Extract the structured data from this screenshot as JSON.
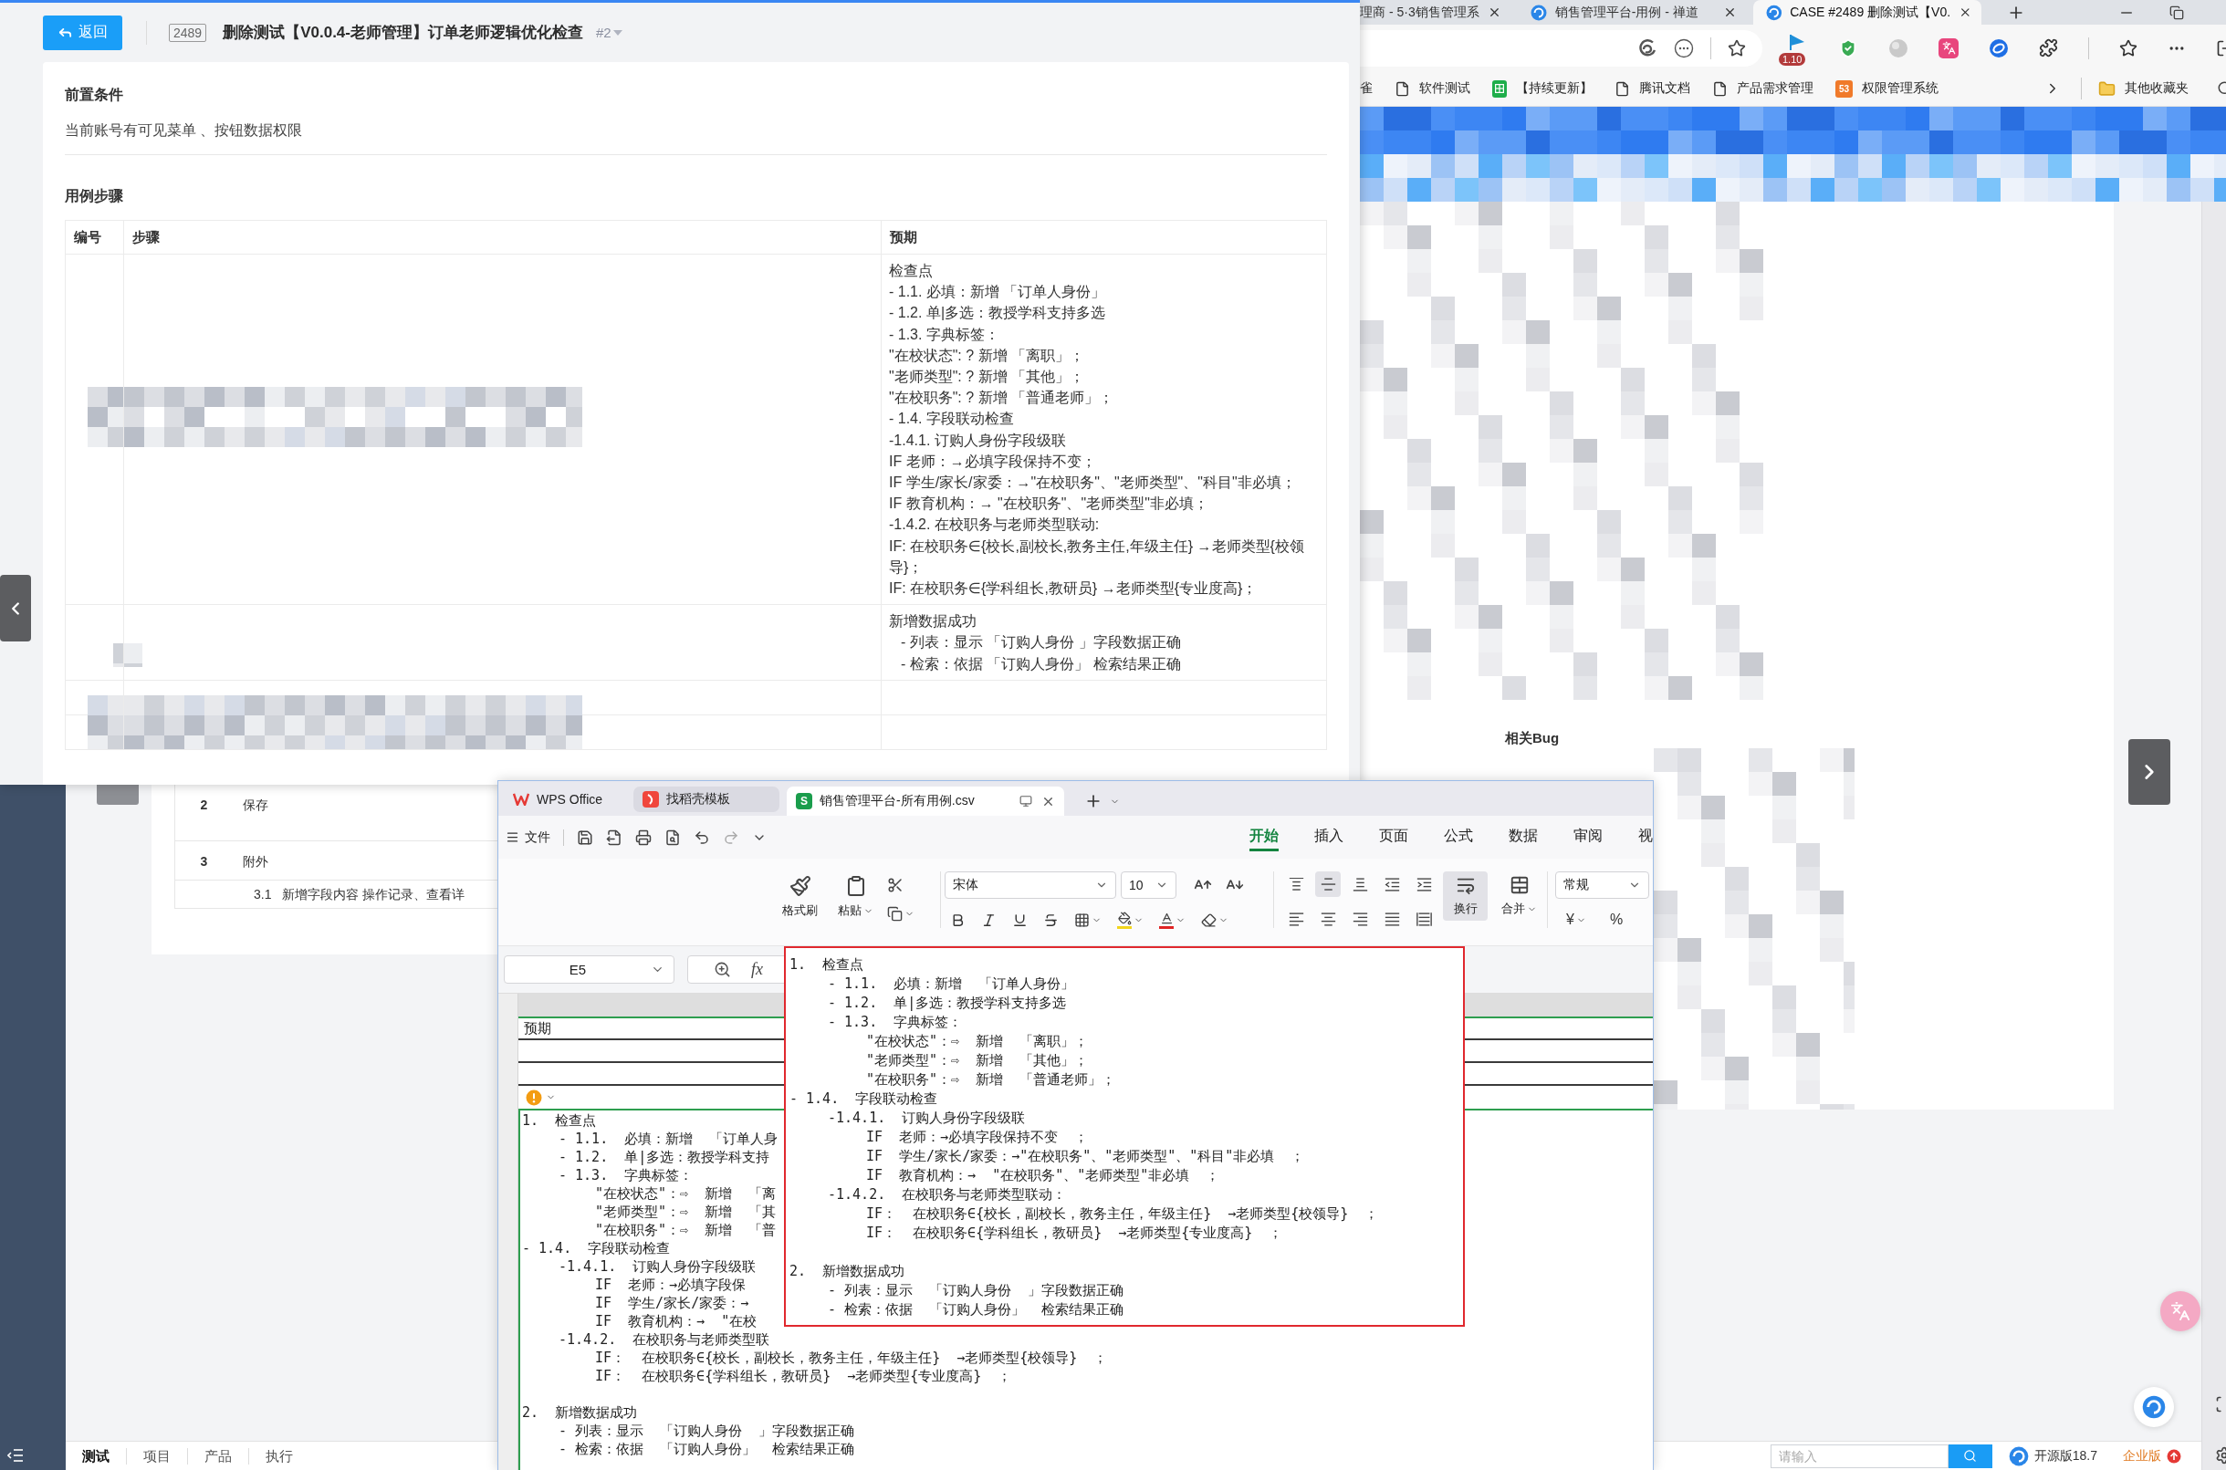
{
  "browser": {
    "tabs": [
      {
        "title": "理商 - 5·3销售管理系",
        "favicon": false,
        "selected": false
      },
      {
        "title": "销售管理平台-用例 - 禅道",
        "favicon": true,
        "selected": false
      },
      {
        "title": "CASE #2489 删除测试【V0.",
        "favicon": true,
        "selected": true
      }
    ],
    "extension_badge": "1.10",
    "bookmarks": [
      {
        "label": "雀",
        "kind": "plain"
      },
      {
        "label": "软件测试",
        "kind": "doc"
      },
      {
        "label": "【持续更新】",
        "kind": "sheet"
      },
      {
        "label": "腾讯文档",
        "kind": "doc"
      },
      {
        "label": "产品需求管理",
        "kind": "doc"
      },
      {
        "label": "权限管理系统",
        "kind": "app",
        "icon_text": "53"
      }
    ],
    "other_bookmarks": "其他收藏夹"
  },
  "page": {
    "related_title": "相关Bug",
    "steps": [
      {
        "number": "2",
        "text": "保存"
      },
      {
        "number": "3",
        "text": "附外",
        "children": [
          {
            "number": "3.1",
            "text": "新增字段内容 操作记录、查看详"
          }
        ]
      }
    ],
    "bottom_nav": [
      {
        "label": "测试",
        "selected": true
      },
      {
        "label": "项目",
        "selected": false
      },
      {
        "label": "产品",
        "selected": false
      },
      {
        "label": "执行",
        "selected": false
      }
    ],
    "search": {
      "placeholder": "请输入"
    },
    "edition": "开源版18.7",
    "upgrade": "企业版"
  },
  "case_panel": {
    "back": "返回",
    "id": "2489",
    "title": "删除测试【V0.0.4-老师管理】订单老师逻辑优化检查",
    "version": "#2",
    "precondition": {
      "heading": "前置条件",
      "text": "当前账号有可见菜单 、按钮数据权限"
    },
    "steps": {
      "heading": "用例步骤",
      "columns": [
        "编号",
        "步骤",
        "预期"
      ],
      "rows": [
        {
          "expected": [
            {
              "text": "检查点"
            },
            {
              "text": "- 1.1. 必填：新增 「订单人身份」"
            },
            {
              "text": "- 1.2. 单|多选：教授学科支持多选"
            },
            {
              "text": "- 1.3. 字典标签："
            },
            {
              "text": "\"在校状态\": ? 新增 「离职」；"
            },
            {
              "text": "\"老师类型\": ? 新增 「其他」；"
            },
            {
              "text": "\"在校职务\": ? 新增 「普通老师」；"
            },
            {
              "text": "- 1.4. 字段联动检查"
            },
            {
              "text": "-1.4.1. 订购人身份字段级联"
            },
            {
              "text": "IF 老师：→必填字段保持不变；"
            },
            {
              "text": "IF 学生/家长/家委：→\"在校职务\"、\"老师类型\"、\"科目\"非必填；"
            },
            {
              "text": "IF 教育机构：→ \"在校职务\"、\"老师类型\"非必填；"
            },
            {
              "text": "-1.4.2. 在校职务与老师类型联动:"
            },
            {
              "text": "IF: 在校职务∈{校长,副校长,教务主任,年级主任} →老师类型{校领导}；"
            },
            {
              "text": "IF: 在校职务∈{学科组长,教研员} →老师类型{专业度高}；"
            }
          ]
        },
        {
          "expected": [
            {
              "text": "新增数据成功",
              "children": [
                {
                  "text": "- 列表：显示 「订购人身份 」字段数据正确"
                },
                {
                  "text": "- 检索：依据 「订购人身份」 检索结果正确"
                }
              ]
            }
          ]
        }
      ]
    }
  },
  "wps": {
    "tabs": [
      {
        "label": "WPS Office",
        "kind": "home",
        "selected": false
      },
      {
        "label": "找稻壳模板",
        "kind": "template",
        "selected": false
      },
      {
        "label": "销售管理平台-所有用例.csv",
        "kind": "sheet",
        "icon_text": "S",
        "selected": true
      }
    ],
    "file_menu": "文件",
    "ribbon_tabs": [
      {
        "label": "开始",
        "selected": true
      },
      {
        "label": "插入",
        "selected": false
      },
      {
        "label": "页面",
        "selected": false
      },
      {
        "label": "公式",
        "selected": false
      },
      {
        "label": "数据",
        "selected": false
      },
      {
        "label": "审阅",
        "selected": false
      },
      {
        "label": "视",
        "selected": false
      }
    ],
    "toolbar": {
      "format_painter": "格式刷",
      "paste": "粘贴",
      "font": "宋体",
      "font_size": "10",
      "vertical_align_buttons": [
        {
          "kind": "top",
          "on": false
        },
        {
          "kind": "middle",
          "on": true
        },
        {
          "kind": "bottom",
          "on": false
        }
      ],
      "wrap": {
        "label": "换行",
        "on": true
      },
      "merge": "合并",
      "number_format": "常规",
      "currency": "¥",
      "percent": "%"
    },
    "name_box": "E5",
    "formula_label": "fx",
    "header_cell": "预期",
    "cell": {
      "blocks": [
        {
          "lines": [
            {
              "text": "1.  检查点",
              "children": [
                {
                  "text": "- 1.1.  必填：新增  「订单人身"
                },
                {
                  "text": "- 1.2.  单|多选：教授学科支持"
                },
                {
                  "text": "- 1.3.  字典标签：",
                  "children": [
                    {
                      "text": "\"在校状态\"：⇨  新增  「离"
                    },
                    {
                      "text": "\"老师类型\"：⇨  新增  「其"
                    },
                    {
                      "text": "\"在校职务\"：⇨  新增  「普"
                    }
                  ]
                }
              ]
            },
            {
              "text": "- 1.4.  字段联动检查",
              "children": [
                {
                  "text": "-1.4.1.  订购人身份字段级联",
                  "children": [
                    {
                      "text": "IF  老师：→必填字段保"
                    },
                    {
                      "text": "IF  学生/家长/家委：→"
                    },
                    {
                      "text": "IF  教育机构：→  \"在校"
                    }
                  ]
                },
                {
                  "text": "-1.4.2.  在校职务与老师类型联",
                  "children": [
                    {
                      "text": "IF：  在校职务∈{校长，副校长，教务主任，年级主任}  →老师类型{校领导}  ；"
                    },
                    {
                      "text": "IF：  在校职务∈{学科组长，教研员}  →老师类型{专业度高}  ；"
                    }
                  ]
                }
              ]
            }
          ]
        },
        {
          "lines": [
            {
              "text": "2.  新增数据成功",
              "children": [
                {
                  "text": "- 列表：显示  「订购人身份  」字段数据正确"
                },
                {
                  "text": "- 检索：依据  「订购人身份」  检索结果正确"
                }
              ]
            }
          ]
        }
      ]
    },
    "popup": {
      "blocks": [
        {
          "lines": [
            {
              "text": "1.  检查点",
              "children": [
                {
                  "text": "- 1.1.  必填：新增  「订单人身份」"
                },
                {
                  "text": "- 1.2.  单|多选：教授学科支持多选"
                },
                {
                  "text": "- 1.3.  字典标签：",
                  "children": [
                    {
                      "text": "\"在校状态\"：⇨  新增  「离职」；"
                    },
                    {
                      "text": "\"老师类型\"：⇨  新增  「其他」；"
                    },
                    {
                      "text": "\"在校职务\"：⇨  新增  「普通老师」；"
                    }
                  ]
                }
              ]
            },
            {
              "text": "- 1.4.  字段联动检查",
              "children": [
                {
                  "text": "-1.4.1.  订购人身份字段级联",
                  "children": [
                    {
                      "text": "IF  老师：→必填字段保持不变  ；"
                    },
                    {
                      "text": "IF  学生/家长/家委：→\"在校职务\"、\"老师类型\"、\"科目\"非必填  ；"
                    },
                    {
                      "text": "IF  教育机构：→  \"在校职务\"、\"老师类型\"非必填  ；"
                    }
                  ]
                },
                {
                  "text": "-1.4.2.  在校职务与老师类型联动：",
                  "children": [
                    {
                      "text": "IF：  在校职务∈{校长，副校长，教务主任，年级主任}  →老师类型{校领导}  ；"
                    },
                    {
                      "text": "IF：  在校职务∈{学科组长，教研员}  →老师类型{专业度高}  ；"
                    }
                  ]
                }
              ]
            }
          ]
        },
        {
          "lines": [
            {
              "text": "2.  新增数据成功",
              "children": [
                {
                  "text": "- 列表：显示  「订购人身份  」字段数据正确"
                },
                {
                  "text": "- 检索：依据  「订购人身份」  检索结果正确"
                }
              ]
            }
          ]
        }
      ]
    }
  }
}
